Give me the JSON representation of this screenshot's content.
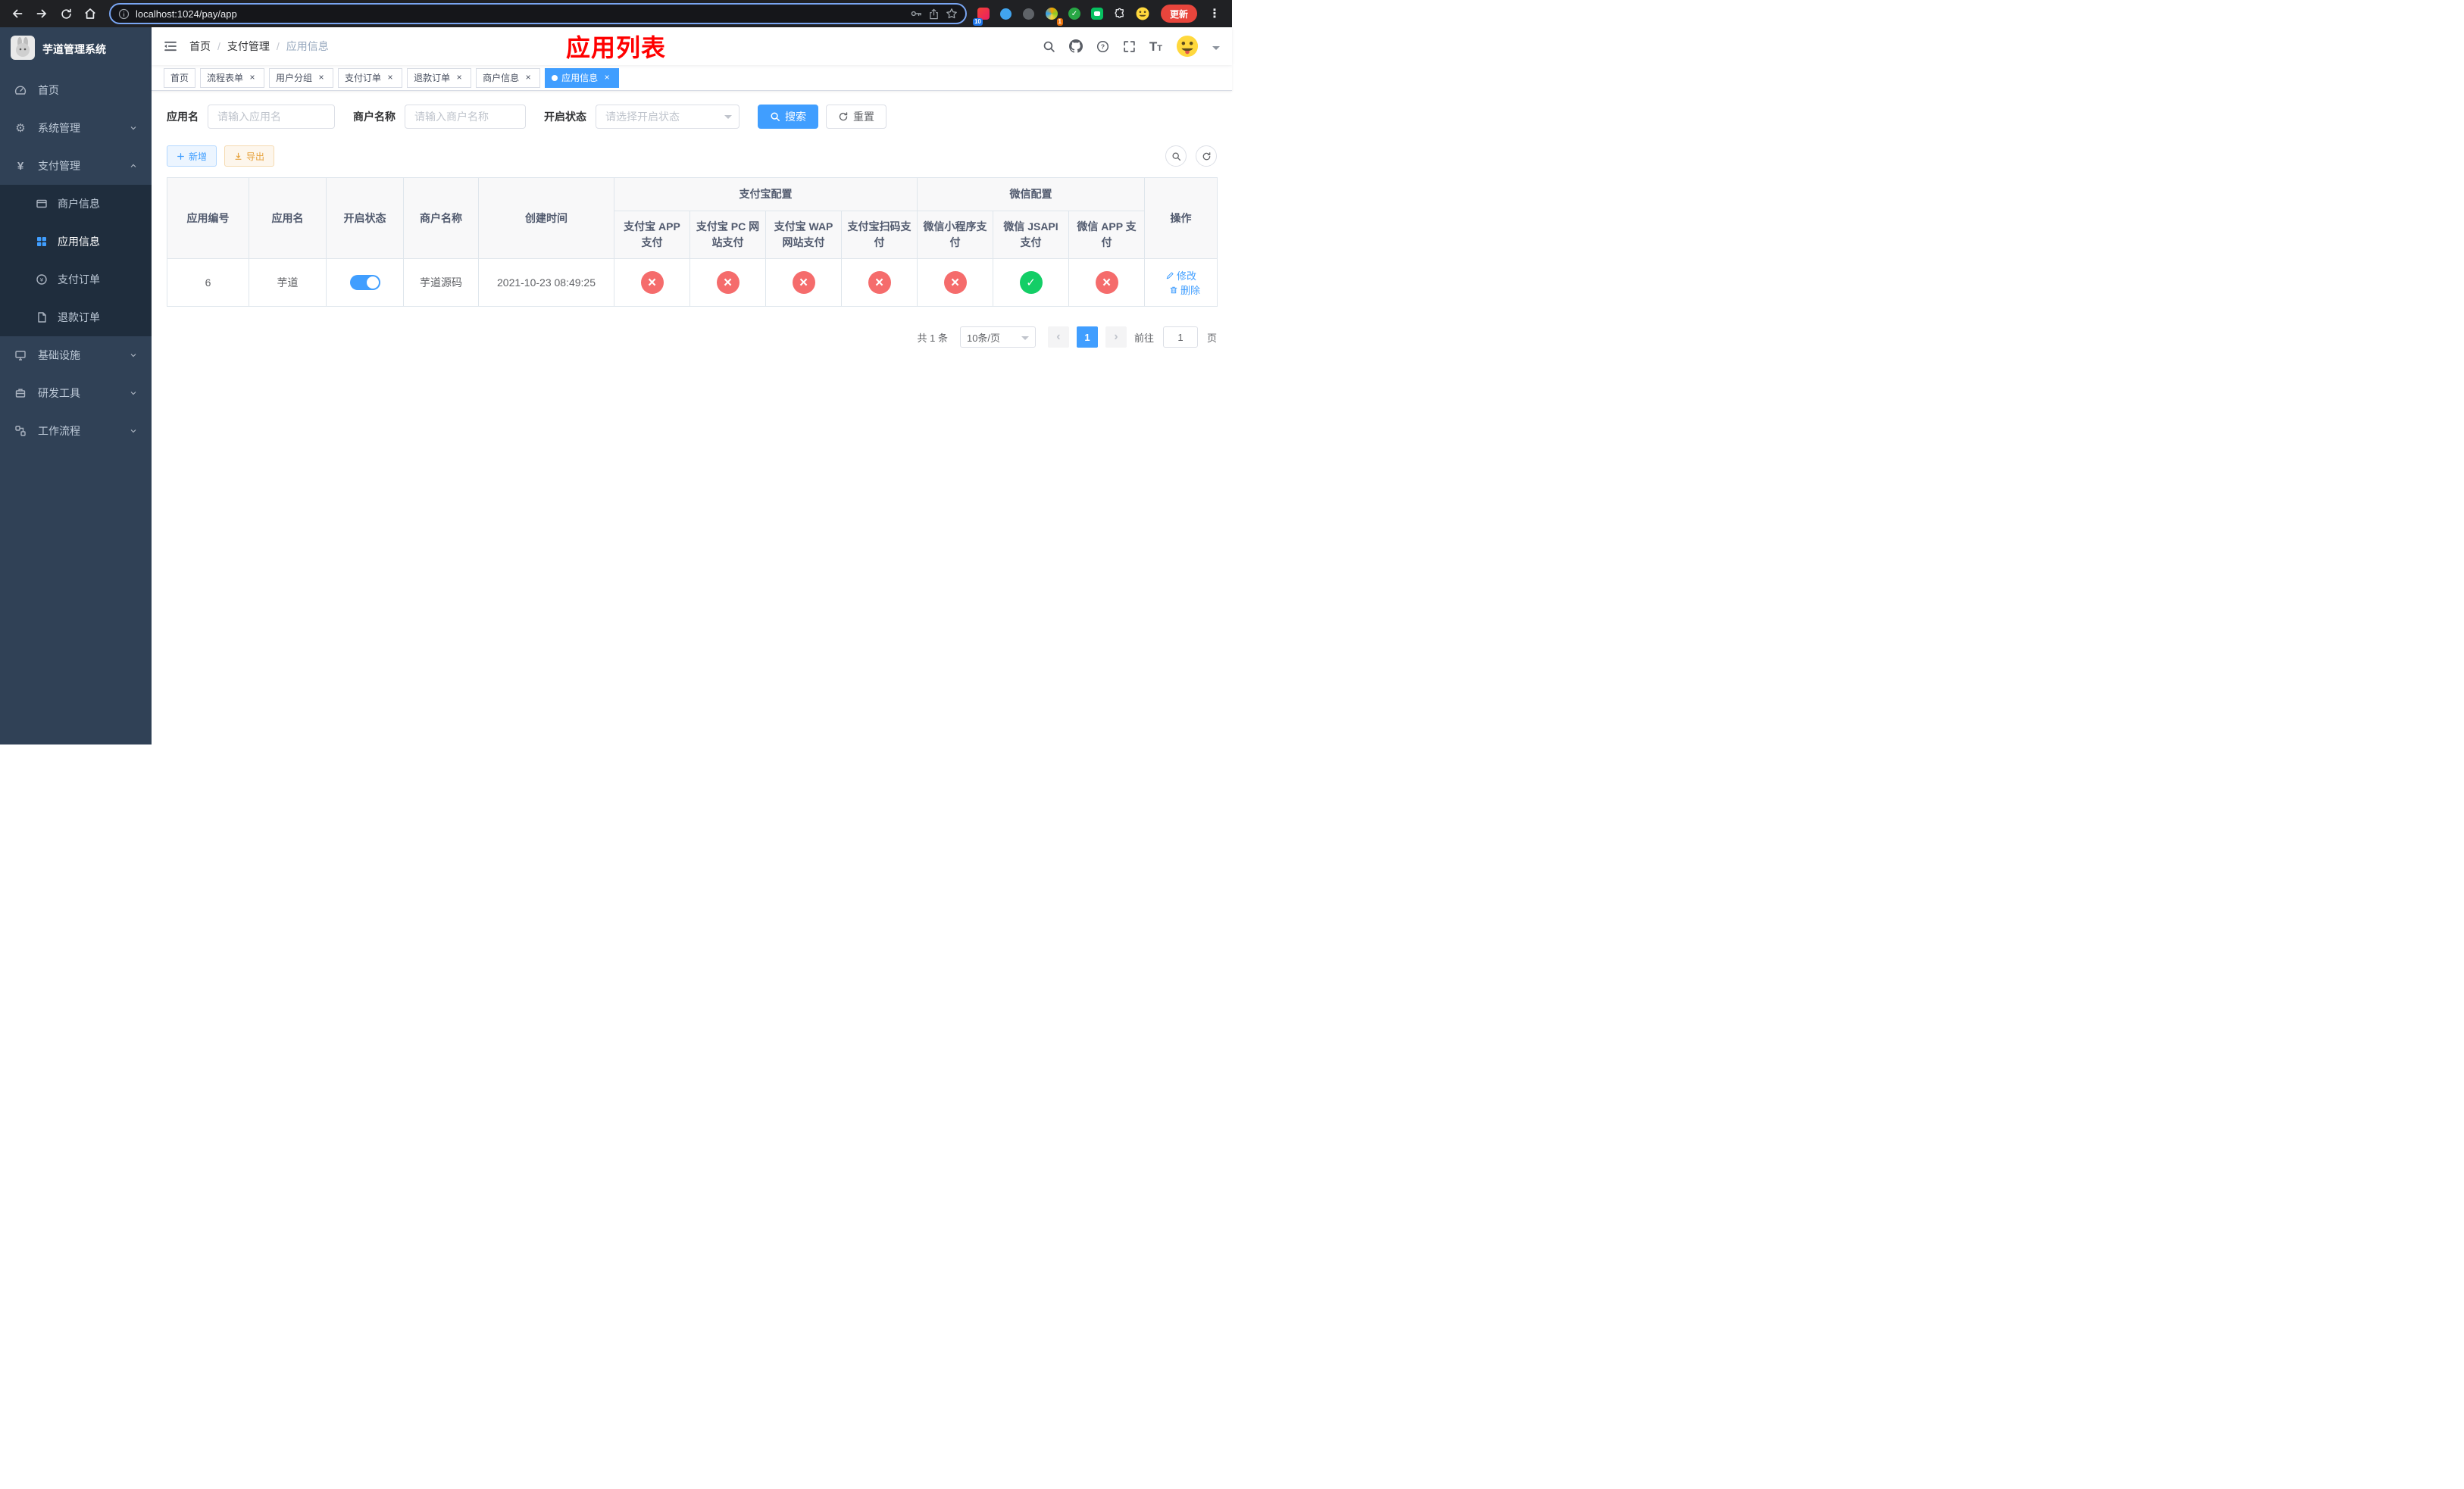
{
  "browser": {
    "url": "localhost:1024/pay/app",
    "update_label": "更新",
    "ext_badge_count": "10",
    "avatar_badge_count": "1"
  },
  "sidebar": {
    "logo_title": "芋道管理系统",
    "items": [
      {
        "label": "首页"
      },
      {
        "label": "系统管理"
      },
      {
        "label": "支付管理"
      },
      {
        "label": "基础设施"
      },
      {
        "label": "研发工具"
      },
      {
        "label": "工作流程"
      }
    ],
    "submenu": [
      {
        "label": "商户信息"
      },
      {
        "label": "应用信息"
      },
      {
        "label": "支付订单"
      },
      {
        "label": "退款订单"
      }
    ]
  },
  "header": {
    "breadcrumb": [
      {
        "label": "首页"
      },
      {
        "label": "支付管理"
      },
      {
        "label": "应用信息"
      }
    ],
    "separator": "/",
    "page_title": "应用列表"
  },
  "tabs": [
    {
      "label": "首页"
    },
    {
      "label": "流程表单"
    },
    {
      "label": "用户分组"
    },
    {
      "label": "支付订单"
    },
    {
      "label": "退款订单"
    },
    {
      "label": "商户信息"
    },
    {
      "label": "应用信息"
    }
  ],
  "filters": {
    "app_name_label": "应用名",
    "app_name_placeholder": "请输入应用名",
    "merchant_label": "商户名称",
    "merchant_placeholder": "请输入商户名称",
    "status_label": "开启状态",
    "status_placeholder": "请选择开启状态",
    "search_button": "搜索",
    "reset_button": "重置"
  },
  "toolbar": {
    "add_button": "新增",
    "export_button": "导出"
  },
  "table": {
    "headers": {
      "app_id": "应用编号",
      "app_name": "应用名",
      "status": "开启状态",
      "merchant": "商户名称",
      "created": "创建时间",
      "alipay_group": "支付宝配置",
      "wechat_group": "微信配置",
      "alipay_app": "支付宝 APP 支付",
      "alipay_pc": "支付宝 PC 网站支付",
      "alipay_wap": "支付宝 WAP 网站支付",
      "alipay_qr": "支付宝扫码支付",
      "wx_mini": "微信小程序支付",
      "wx_jsapi": "微信 JSAPI 支付",
      "wx_app": "微信 APP 支付",
      "actions": "操作"
    },
    "rows": [
      {
        "app_id": "6",
        "app_name": "芋道",
        "enabled": true,
        "merchant": "芋道源码",
        "created": "2021-10-23 08:49:25",
        "alipay_app": false,
        "alipay_pc": false,
        "alipay_wap": false,
        "alipay_qr": false,
        "wx_mini": false,
        "wx_jsapi": true,
        "wx_app": false,
        "edit_label": "修改",
        "delete_label": "删除"
      }
    ]
  },
  "pagination": {
    "total": "共 1 条",
    "page_size": "10条/页",
    "page": "1",
    "goto_label": "前往",
    "goto_value": "1",
    "page_unit": "页"
  },
  "colors": {
    "accent": "#409eff",
    "success": "#13ce66",
    "danger": "#f56c6c",
    "page_title": "#ff0000",
    "sidebar_bg": "#304156"
  }
}
